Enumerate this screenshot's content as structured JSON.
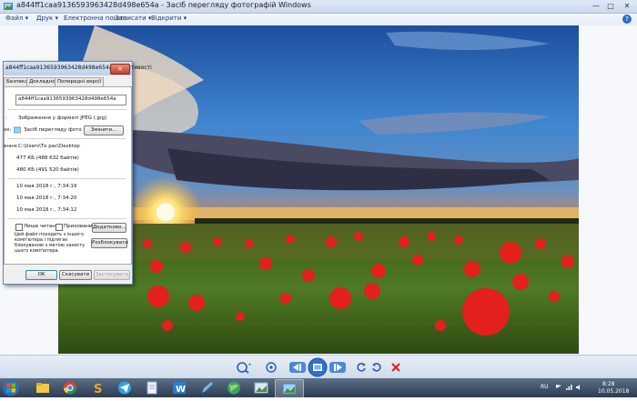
{
  "window": {
    "title": "a844ff1caa9136593963428d498e654a - Засіб перегляду фотографій Windows",
    "controls": [
      "—",
      "□",
      "✕"
    ]
  },
  "menu": {
    "items": [
      "Файл ▾",
      "Друк ▾",
      "Електронна пошта",
      "Записати ▾",
      "Відкрити ▾"
    ],
    "help": "?"
  },
  "dialog": {
    "title": "a844ff1caa9136593963428d498e654a - властивості",
    "close": "✕",
    "tabs": [
      "Безпека",
      "Докладно",
      "Попередні версії"
    ],
    "filename": "a844ff1caa9136593963428d498e654a",
    "type_label": ":",
    "type_value": "Зображення у форматі JPEG (.jpg)",
    "opens_label": "ок:",
    "opens_value": "Засіб перегляду фото",
    "change_button": "Змінити...",
    "location_label": "ення:",
    "location_value": "C:\\Users\\То рас\\Desktop",
    "size_value": "477 КБ (488 632 байтів)",
    "size_on_disk_value": "480 КБ (491 520 байтів)",
    "created_value": "10 мая 2018 г., 7:34:19",
    "modified_value": "10 мая 2018 г., 7:34:20",
    "accessed_value": "10 мая 2018 г., 7:34:12",
    "readonly_label": "Лише читання",
    "hidden_label": "Прихований",
    "advanced_button": "Додатково...",
    "security_note": "Цей файл походить з іншого комп'ютера і підлягає блокуванню з метою захисту цього комп'ютера.",
    "unblock_button": "Розблокувати",
    "ok_button": "OK",
    "cancel_button": "Скасувати",
    "apply_button": "Застосувати"
  },
  "taskbar": {
    "lang": "RU",
    "time": "8:28",
    "date": "10.05.2018"
  },
  "colors": {
    "accent": "#2a6fd1",
    "taskbar": "#2c3c52",
    "toolbar": "#cfdbea"
  },
  "icons": [
    "windows-start-icon",
    "explorer-icon",
    "chrome-icon",
    "app-s-icon",
    "telegram-icon",
    "notes-icon",
    "word-icon",
    "pencil-icon",
    "globe-icon",
    "photos-icon",
    "photo-viewer-icon"
  ]
}
